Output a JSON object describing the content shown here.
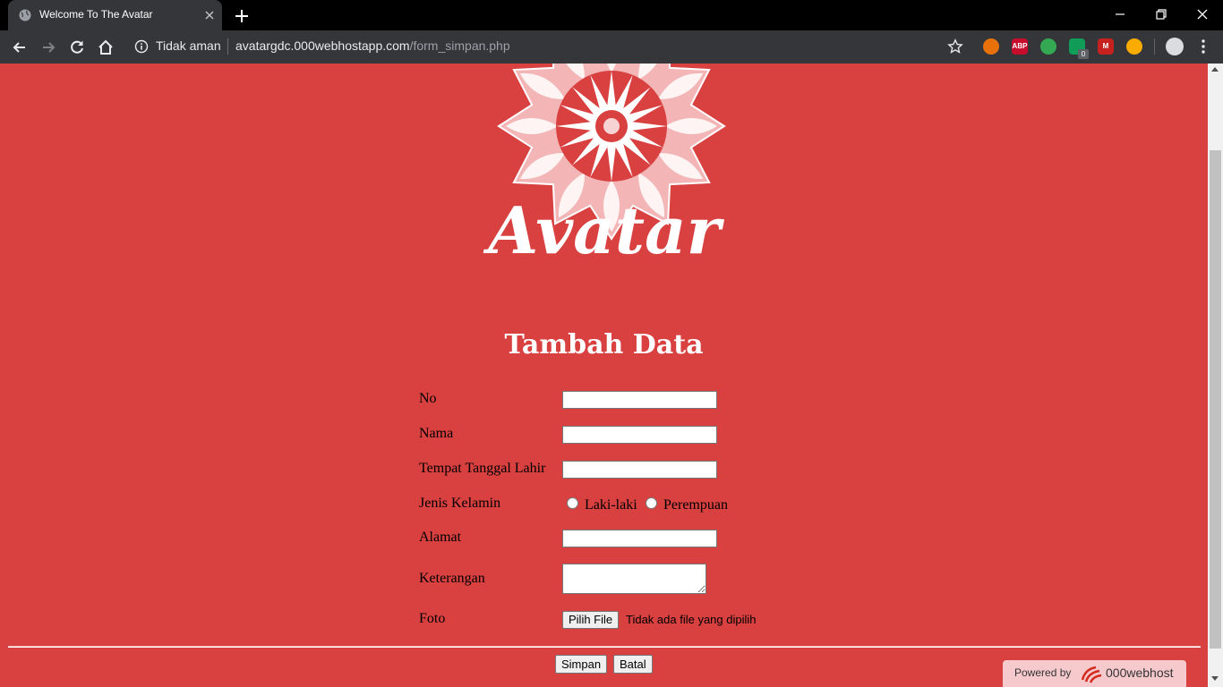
{
  "browser": {
    "tab_title": "Welcome To The Avatar",
    "security_label": "Tidak aman",
    "url_domain": "avatargdc.000webhostapp.com",
    "url_path": "/form_simpan.php",
    "extensions": [
      {
        "name": "fire-extension-icon",
        "text": "",
        "color": "#e8710a"
      },
      {
        "name": "adblock-plus-icon",
        "text": "ABP",
        "color": "#c70d2c"
      },
      {
        "name": "colorful-extension-icon",
        "text": "",
        "color": "#34a853"
      },
      {
        "name": "shield-check-extension-icon",
        "text": "",
        "color": "#0f9d58"
      },
      {
        "name": "m-extension-icon",
        "text": "M",
        "color": "#c5221f"
      },
      {
        "name": "pill-extension-icon",
        "text": "",
        "color": "#f9ab00"
      }
    ],
    "extension_badge": "0"
  },
  "page": {
    "logo_text": "Avatar",
    "heading": "Tambah Data",
    "form": {
      "no_label": "No",
      "nama_label": "Nama",
      "ttl_label": "Tempat Tanggal Lahir",
      "jk_label": "Jenis Kelamin",
      "male_option": "Laki-laki",
      "female_option": "Perempuan",
      "alamat_label": "Alamat",
      "keterangan_label": "Keterangan",
      "foto_label": "Foto",
      "file_button": "Pilih File",
      "file_status": "Tidak ada file yang dipilih",
      "no_value": "",
      "nama_value": "",
      "ttl_value": "",
      "alamat_value": "",
      "keterangan_value": ""
    },
    "buttons": {
      "save": "Simpan",
      "cancel": "Batal"
    },
    "powered": {
      "label": "Powered by",
      "brand": "000webhost"
    }
  },
  "colors": {
    "page_background": "#d94040",
    "chrome_dark": "#35363a"
  }
}
